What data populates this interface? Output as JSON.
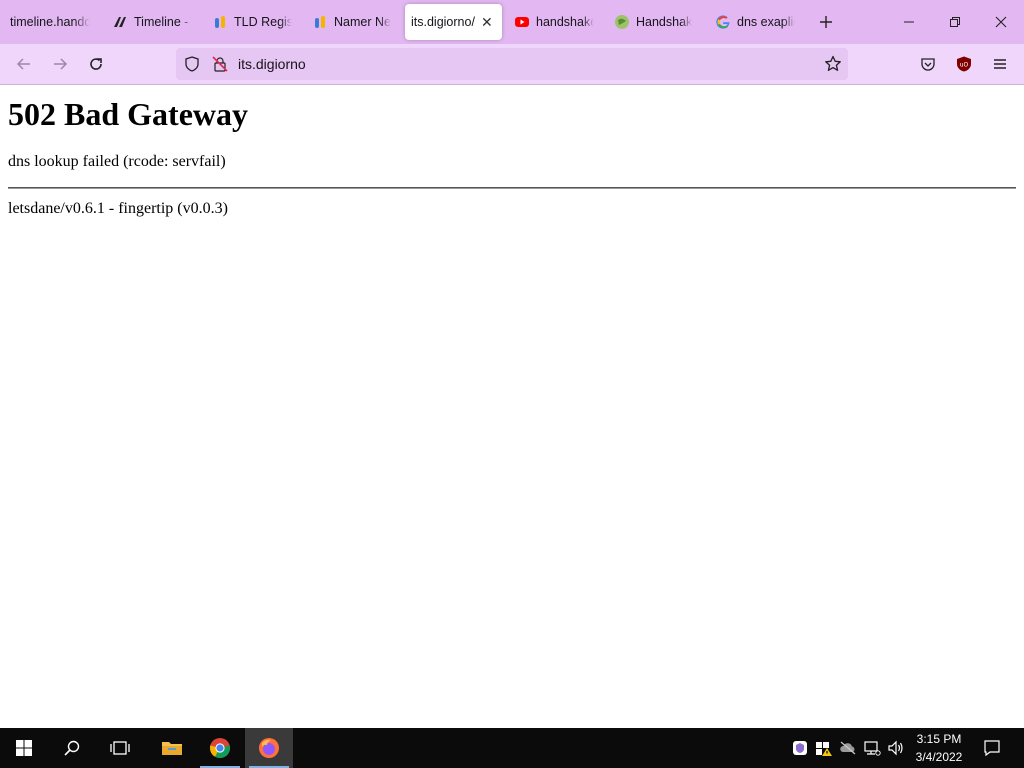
{
  "browser": {
    "tabs": [
      {
        "label": "timeline.handd",
        "icon": "none"
      },
      {
        "label": "Timeline - |",
        "icon": "timeline-logo-icon"
      },
      {
        "label": "TLD Regist",
        "icon": "namer-logo-icon"
      },
      {
        "label": "Namer Ne",
        "icon": "namer-logo-icon"
      },
      {
        "label": "its.digiorno/",
        "icon": "none",
        "active": true
      },
      {
        "label": "handshake",
        "icon": "youtube-icon"
      },
      {
        "label": "Handshak",
        "icon": "globe-icon"
      },
      {
        "label": "dns exaplin",
        "icon": "google-icon"
      }
    ],
    "url": "its.digiorno",
    "colors": {
      "tabstrip": "#e3b8f2",
      "navbar": "#f1d6fb",
      "urlbar": "#e6c6f3"
    }
  },
  "page": {
    "heading": "502 Bad Gateway",
    "message": "dns lookup failed (rcode: servfail)",
    "footer": "letsdane/v0.6.1 - fingertip (v0.0.3)"
  },
  "taskbar": {
    "time": "3:15 PM",
    "date": "3/4/2022",
    "pinned": [
      "windows-start-icon",
      "search-icon",
      "task-view-icon",
      "file-explorer-icon",
      "chrome-icon",
      "firefox-icon"
    ]
  }
}
